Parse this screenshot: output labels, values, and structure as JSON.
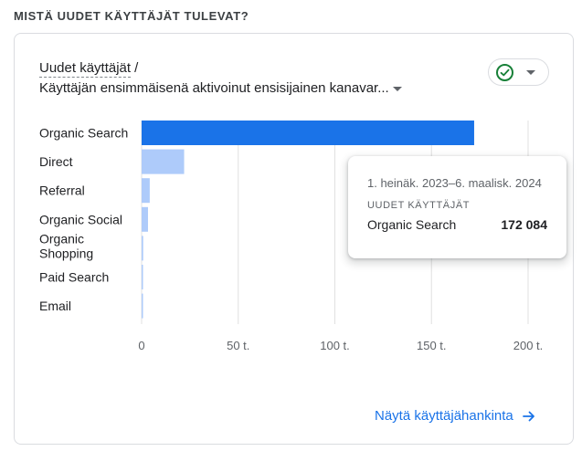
{
  "section_title": "MISTÄ UUDET KÄYTTÄJÄT TULEVAT?",
  "card": {
    "metric_label": "Uudet käyttäjät",
    "metric_separator": "/",
    "dimension_label": "Käyttäjän ensimmäisenä aktivoinut ensisijainen kanavar...",
    "status_icon": "check-circle-icon",
    "footer_link": "Näytä käyttäjähankinta"
  },
  "tooltip": {
    "date_range": "1. heinäk. 2023–6. maalisk. 2024",
    "metric": "UUDET KÄYTTÄJÄT",
    "channel": "Organic Search",
    "value": "172 084"
  },
  "colors": {
    "highlight": "#1a73e8",
    "bar": "#aecbfa",
    "grid": "#e0e0e0",
    "success": "#188038",
    "link": "#1a73e8"
  },
  "chart_data": {
    "type": "bar",
    "orientation": "horizontal",
    "categories": [
      "Organic Search",
      "Direct",
      "Referral",
      "Organic Social",
      "Organic Shopping",
      "Paid Search",
      "Email"
    ],
    "values": [
      172084,
      22000,
      4200,
      3300,
      800,
      700,
      500
    ],
    "highlighted": "Organic Search",
    "xlim": [
      0,
      200000
    ],
    "x_ticks": [
      0,
      50000,
      100000,
      150000,
      200000
    ],
    "x_tick_labels": [
      "0",
      "50 t.",
      "100 t.",
      "150 t.",
      "200 t."
    ],
    "grid": true
  }
}
